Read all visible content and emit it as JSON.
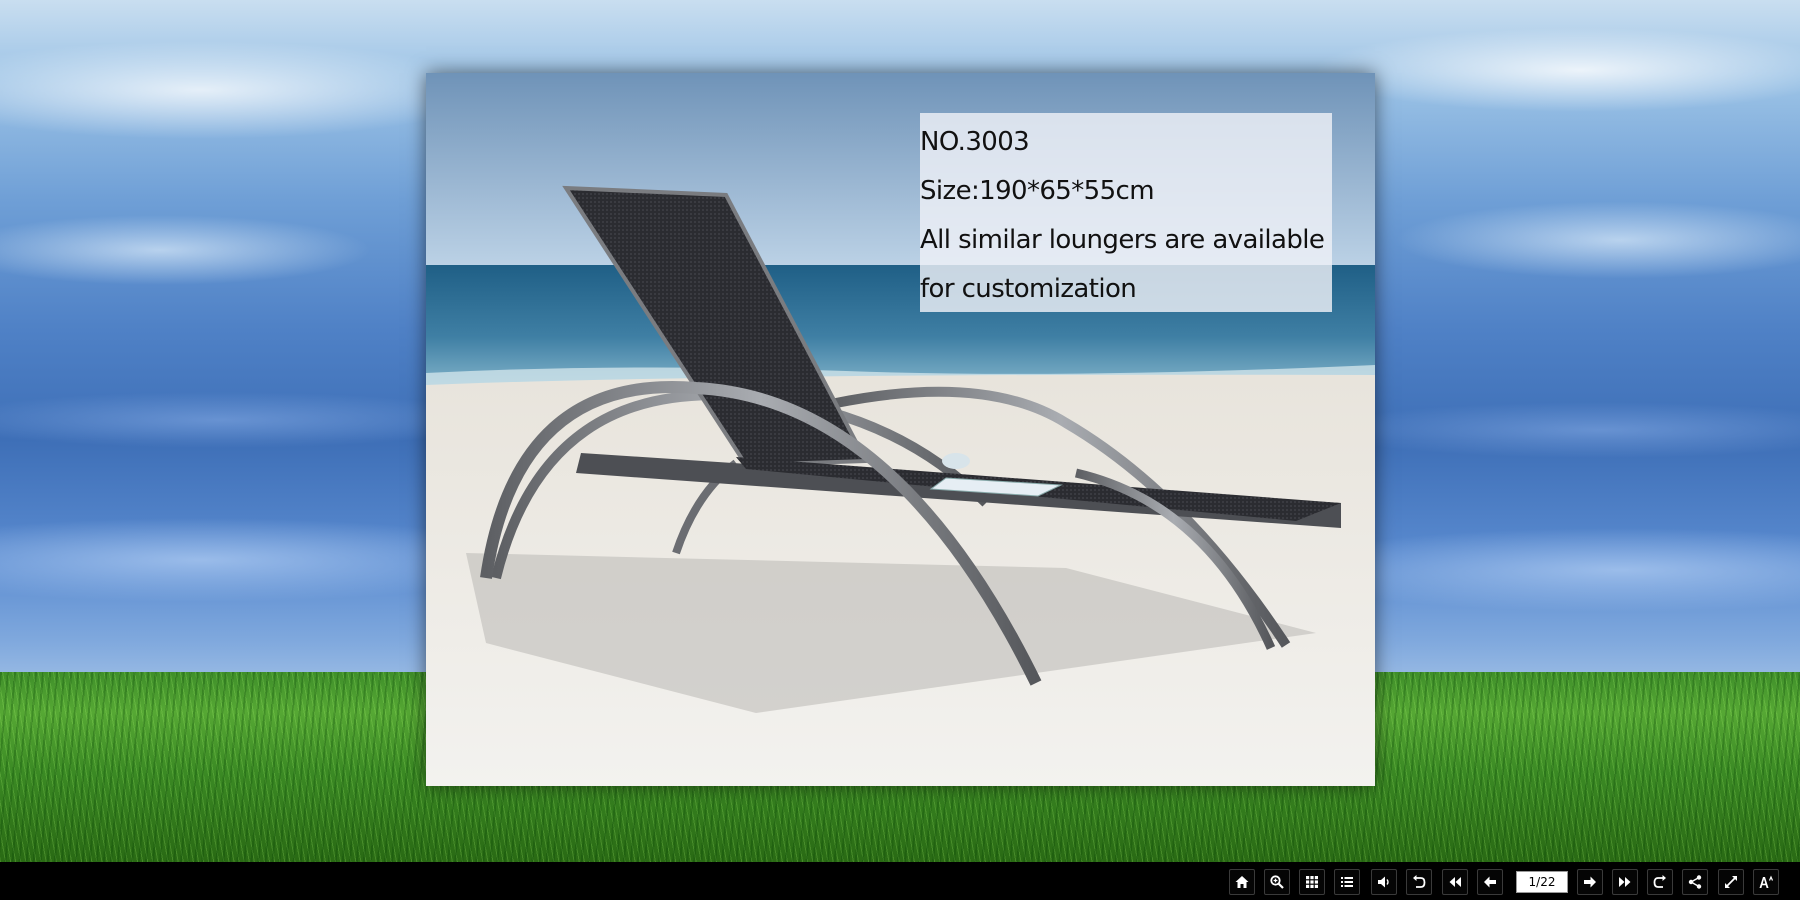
{
  "product_page": {
    "model_number": "NO.3003",
    "size": "Size:190*65*55cm",
    "note_line1": "All similar loungers are available",
    "note_line2": "for customization"
  },
  "toolbar": {
    "page_indicator": "1/22",
    "buttons": [
      "home",
      "zoom",
      "thumbnails",
      "table-of-contents",
      "sound",
      "undo",
      "first-page",
      "previous-page",
      "next-page",
      "last-page",
      "redo",
      "share",
      "fullscreen",
      "font-size"
    ]
  }
}
